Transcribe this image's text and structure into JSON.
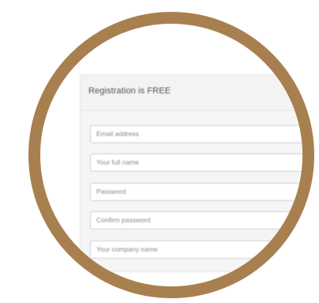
{
  "form": {
    "title": "Registration is FREE",
    "fields": [
      {
        "placeholder": "Email address"
      },
      {
        "placeholder": "Your full name"
      },
      {
        "placeholder": "Password"
      },
      {
        "placeholder": "Confirm password"
      },
      {
        "placeholder": "Your company name"
      }
    ]
  },
  "colors": {
    "ring": "#a8804f",
    "panel_bg": "#f5f5f5",
    "field_border": "#cfcfcf"
  }
}
